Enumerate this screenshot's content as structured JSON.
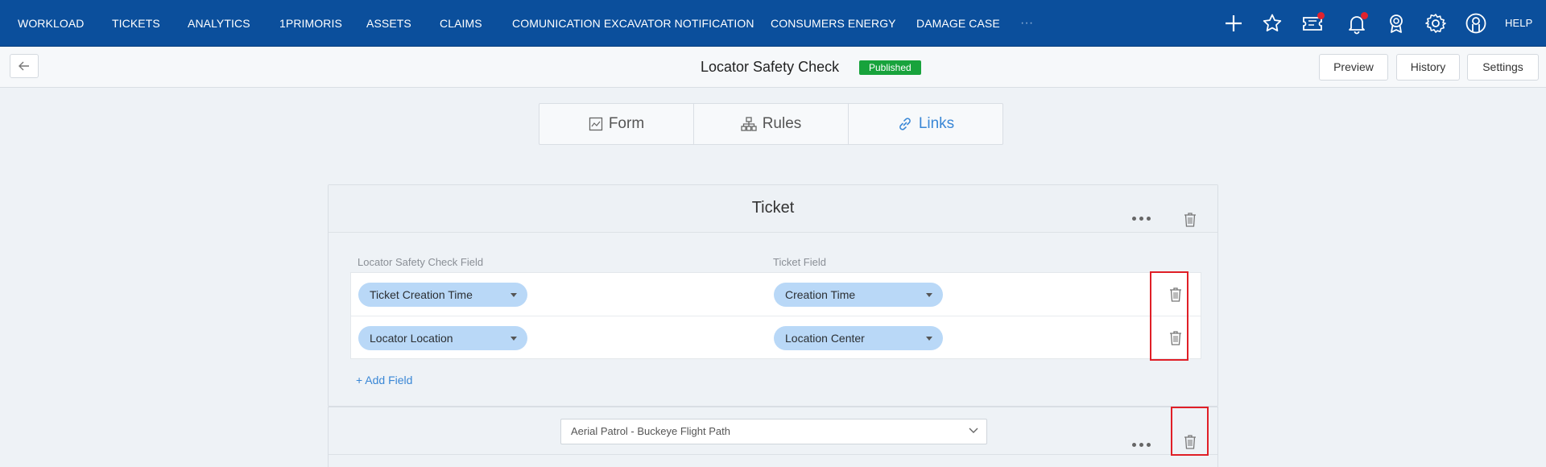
{
  "nav": {
    "items": [
      "WORKLOAD",
      "TICKETS",
      "ANALYTICS",
      "1PRIMORIS",
      "ASSETS",
      "CLAIMS",
      "COMUNICATION EXCAVATOR NOTIFICATION",
      "CONSUMERS ENERGY",
      "DAMAGE CASE"
    ],
    "more": "···",
    "help": "HELP",
    "icons": [
      "plus-icon",
      "star-icon",
      "ticket-icon",
      "bell-icon",
      "award-icon",
      "gear-icon",
      "user-icon"
    ]
  },
  "header": {
    "title": "Locator Safety Check",
    "status": "Published",
    "buttons": {
      "preview": "Preview",
      "history": "History",
      "settings": "Settings"
    }
  },
  "tabs": [
    {
      "label": "Form",
      "icon": "form-icon"
    },
    {
      "label": "Rules",
      "icon": "rules-icon"
    },
    {
      "label": "Links",
      "icon": "link-icon",
      "active": true
    }
  ],
  "ticket_card": {
    "title": "Ticket",
    "col_left": "Locator Safety Check Field",
    "col_right": "Ticket Field",
    "rows": [
      {
        "left": "Ticket Creation Time",
        "right": "Creation Time"
      },
      {
        "left": "Locator Location",
        "right": "Location Center"
      }
    ],
    "add_field": "+ Add Field"
  },
  "second_card": {
    "select_value": "Aerial Patrol - Buckeye Flight Path"
  },
  "colors": {
    "nav_bg": "#0b4f9c",
    "accent": "#3a87d6",
    "published": "#18a33c",
    "pill": "#b9d8f7",
    "highlight": "#e01f27"
  }
}
